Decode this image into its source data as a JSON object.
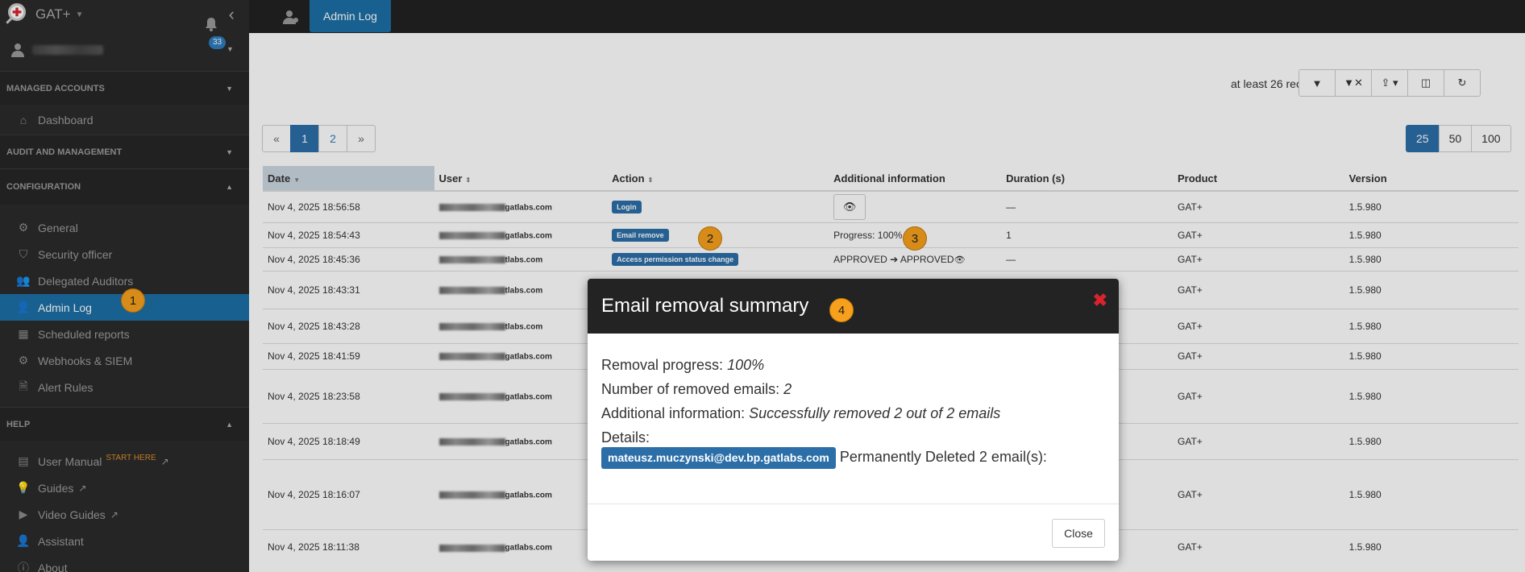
{
  "app": {
    "name": "GAT+"
  },
  "user": {
    "notifications": "33"
  },
  "sidebar": {
    "sections": {
      "managed": "MANAGED ACCOUNTS",
      "audit": "AUDIT AND MANAGEMENT",
      "config": "CONFIGURATION",
      "help": "HELP"
    },
    "dashboard": "Dashboard",
    "config_items": [
      "General",
      "Security officer",
      "Delegated Auditors",
      "Admin Log",
      "Scheduled reports",
      "Webhooks & SIEM",
      "Alert Rules"
    ],
    "help_items": [
      "User Manual",
      "Guides",
      "Video Guides",
      "Assistant",
      "About"
    ],
    "start_here": "START HERE"
  },
  "topbar": {
    "active_tab": "Admin Log"
  },
  "main": {
    "records_text": "at least 26 records",
    "pager": [
      "«",
      "1",
      "2",
      "»"
    ],
    "page_sizes": [
      "25",
      "50",
      "100"
    ],
    "columns": [
      "Date",
      "User",
      "Action",
      "Additional information",
      "Duration (s)",
      "Product",
      "Version"
    ],
    "rows": [
      {
        "date": "Nov 4, 2025 18:56:58",
        "domain": "gatlabs.com",
        "action": "Login",
        "info": "",
        "duration": "—",
        "product": "GAT+",
        "version": "1.5.980"
      },
      {
        "date": "Nov 4, 2025 18:54:43",
        "domain": "gatlabs.com",
        "action": "Email remove",
        "info": "Progress: 100%.",
        "duration": "1",
        "product": "GAT+",
        "version": "1.5.980"
      },
      {
        "date": "Nov 4, 2025 18:45:36",
        "domain": "tlabs.com",
        "action": "Access permission status change",
        "info_from": "APPROVED",
        "info_to": "APPROVED",
        "duration": "—",
        "product": "GAT+",
        "version": "1.5.980"
      },
      {
        "date": "Nov 4, 2025 18:43:31",
        "domain": "tlabs.com",
        "product": "GAT+",
        "version": "1.5.980"
      },
      {
        "date": "Nov 4, 2025 18:43:28",
        "domain": "tlabs.com",
        "product": "GAT+",
        "version": "1.5.980"
      },
      {
        "date": "Nov 4, 2025 18:41:59",
        "domain": "gatlabs.com",
        "product": "GAT+",
        "version": "1.5.980"
      },
      {
        "date": "Nov 4, 2025 18:23:58",
        "domain": "gatlabs.com",
        "product": "GAT+",
        "version": "1.5.980"
      },
      {
        "date": "Nov 4, 2025 18:18:49",
        "domain": "gatlabs.com",
        "product": "GAT+",
        "version": "1.5.980"
      },
      {
        "date": "Nov 4, 2025 18:16:07",
        "domain": "gatlabs.com",
        "product": "GAT+",
        "version": "1.5.980"
      },
      {
        "date": "Nov 4, 2025 18:11:38",
        "domain": "gatlabs.com",
        "product": "GAT+",
        "version": "1.5.980"
      }
    ]
  },
  "modal": {
    "title": "Email removal summary",
    "progress_label": "Removal progress:",
    "progress_value": "100%",
    "removed_label": "Number of removed emails:",
    "removed_value": "2",
    "info_label": "Additional information:",
    "info_value": "Successfully removed 2 out of 2 emails",
    "details_label": "Details:",
    "email": "mateusz.muczynski@dev.bp.gatlabs.com",
    "details_text": "Permanently Deleted 2 email(s):",
    "close_button": "Close"
  },
  "annotations": [
    "1",
    "2",
    "3",
    "4"
  ],
  "colors": {
    "accent": "#1c6fa6",
    "badge": "#f7a01c",
    "close_x": "#d9232d"
  }
}
